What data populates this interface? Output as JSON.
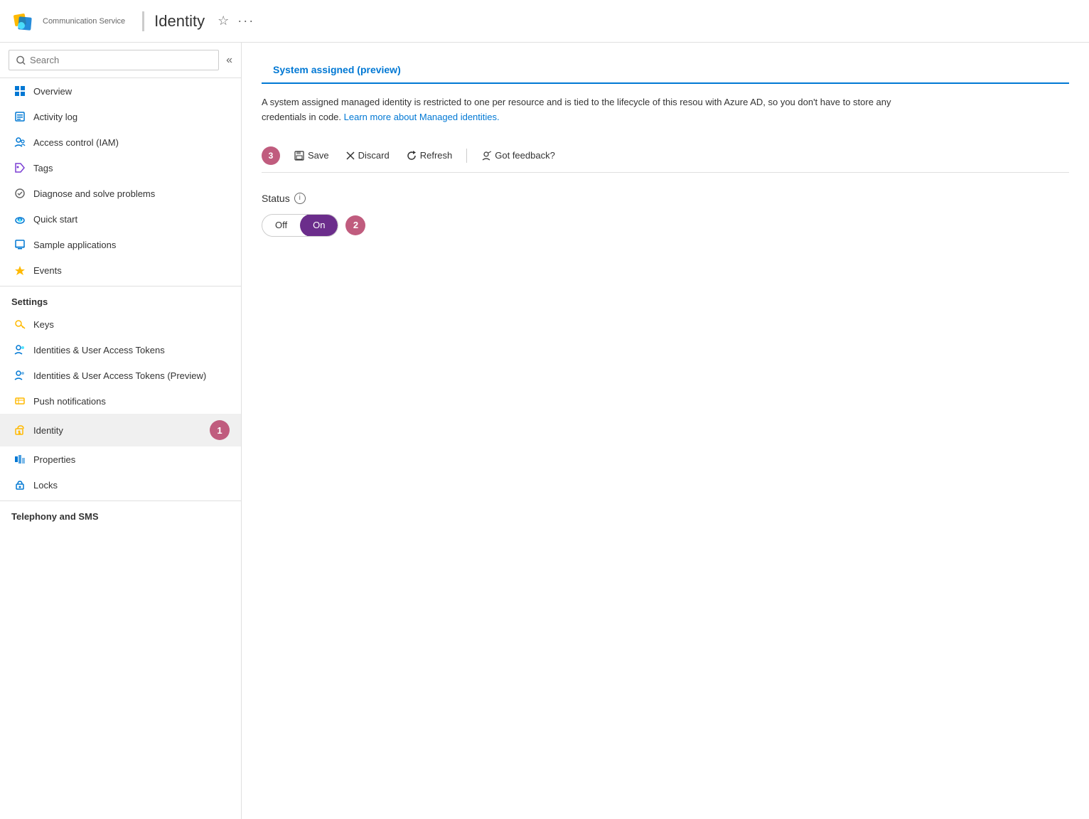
{
  "header": {
    "logo_label": "Communication Service",
    "page_title": "Identity",
    "star_icon": "☆",
    "more_icon": "···"
  },
  "sidebar": {
    "search_placeholder": "Search",
    "collapse_icon": "«",
    "items": [
      {
        "id": "overview",
        "label": "Overview",
        "icon": "overview"
      },
      {
        "id": "activity-log",
        "label": "Activity log",
        "icon": "activity"
      },
      {
        "id": "access-control",
        "label": "Access control (IAM)",
        "icon": "access"
      },
      {
        "id": "tags",
        "label": "Tags",
        "icon": "tags"
      },
      {
        "id": "diagnose",
        "label": "Diagnose and solve problems",
        "icon": "diagnose"
      },
      {
        "id": "quick-start",
        "label": "Quick start",
        "icon": "quickstart"
      },
      {
        "id": "sample-apps",
        "label": "Sample applications",
        "icon": "samples"
      },
      {
        "id": "events",
        "label": "Events",
        "icon": "events"
      }
    ],
    "settings_header": "Settings",
    "settings_items": [
      {
        "id": "keys",
        "label": "Keys",
        "icon": "keys"
      },
      {
        "id": "identities-tokens",
        "label": "Identities & User Access Tokens",
        "icon": "identities"
      },
      {
        "id": "identities-tokens-preview",
        "label": "Identities & User Access Tokens (Preview)",
        "icon": "identities2"
      },
      {
        "id": "push-notifications",
        "label": "Push notifications",
        "icon": "push"
      },
      {
        "id": "identity",
        "label": "Identity",
        "icon": "identity",
        "active": true
      },
      {
        "id": "properties",
        "label": "Properties",
        "icon": "properties"
      },
      {
        "id": "locks",
        "label": "Locks",
        "icon": "locks"
      }
    ],
    "telephony_header": "Telephony and SMS",
    "step1_badge": "1"
  },
  "main": {
    "tab_label": "System assigned (preview)",
    "description_text": "A system assigned managed identity is restricted to one per resource and is tied to the lifecycle of this resou with Azure AD, so you don't have to store any credentials in code.",
    "description_link": "Learn more about Managed identities.",
    "toolbar": {
      "save_label": "Save",
      "discard_label": "Discard",
      "refresh_label": "Refresh",
      "feedback_label": "Got feedback?",
      "step3_badge": "3"
    },
    "status": {
      "label": "Status",
      "off_label": "Off",
      "on_label": "On",
      "step2_badge": "2"
    }
  }
}
